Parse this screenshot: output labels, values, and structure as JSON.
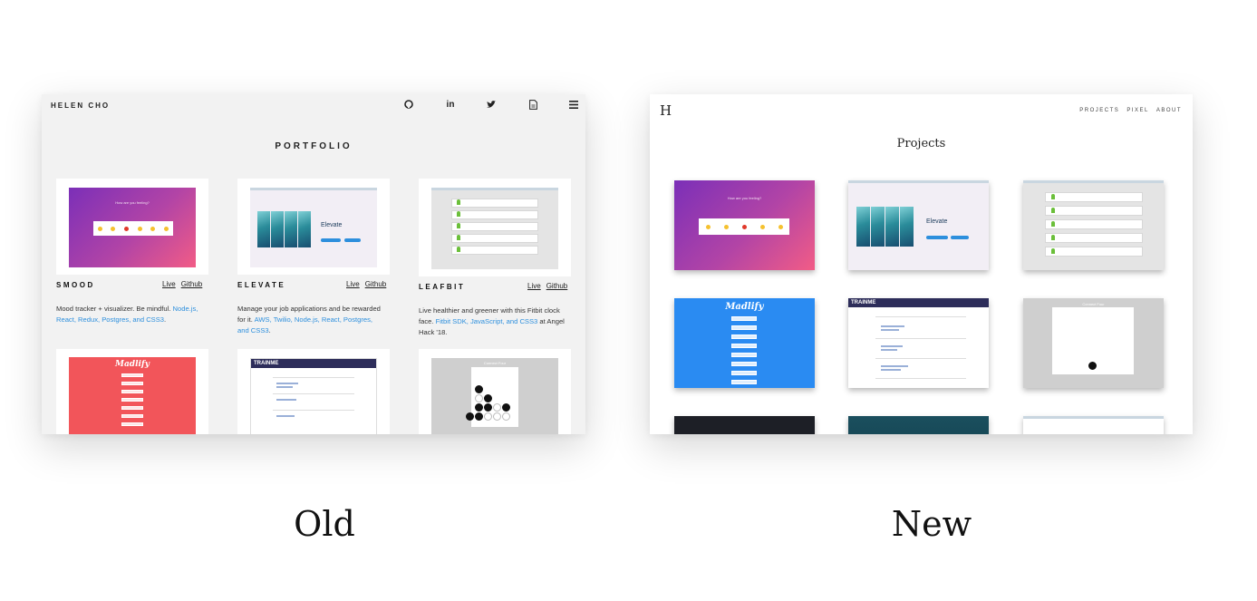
{
  "captions": {
    "old": "Old",
    "new": "New"
  },
  "old_site": {
    "brand": "HELEN CHO",
    "nav_icons": [
      "github-icon",
      "linkedin-icon",
      "twitter-icon",
      "resume-document-icon",
      "hamburger-menu-icon"
    ],
    "nav_glyphs": {
      "linkedin": "in",
      "menu": "≡"
    },
    "page_title": "PORTFOLIO",
    "projects": [
      {
        "name": "SMOOD",
        "live": "Live",
        "github": "Github",
        "desc": "Mood tracker + visualizer. Be mindful.",
        "tech": "Node.js, React, Redux, Postgres, and CSS3",
        "tail": "."
      },
      {
        "name": "ELEVATE",
        "live": "Live",
        "github": "Github",
        "desc": "Manage your job applications and be rewarded for it.",
        "tech": "AWS, Twilio, Node.js, React, Postgres, and CSS3",
        "tail": "."
      },
      {
        "name": "LEAFBIT",
        "live": "Live",
        "github": "Github",
        "desc": "Live healthier and greener with this Fitbit clock face.",
        "tech": "Fitbit SDK, JavaScript, and CSS3",
        "tail": "at Angel Hack '18."
      }
    ],
    "thumb_text": {
      "mood_question": "How are you feeling?",
      "elevate": "Elevate",
      "madlify": "Madlify",
      "trainme": "TRAINME",
      "connect_four": "Connect Four"
    }
  },
  "new_site": {
    "logo": "H",
    "nav": [
      "PROJECTS",
      "PIXEL",
      "ABOUT"
    ],
    "page_title": "Projects"
  },
  "colors": {
    "link_blue": "#2d8fdd",
    "mood_gradient_start": "#7b2fb8",
    "mood_gradient_end": "#f25c86",
    "madlify_blue": "#2a8bf2",
    "madlify_red": "#f2555a"
  }
}
